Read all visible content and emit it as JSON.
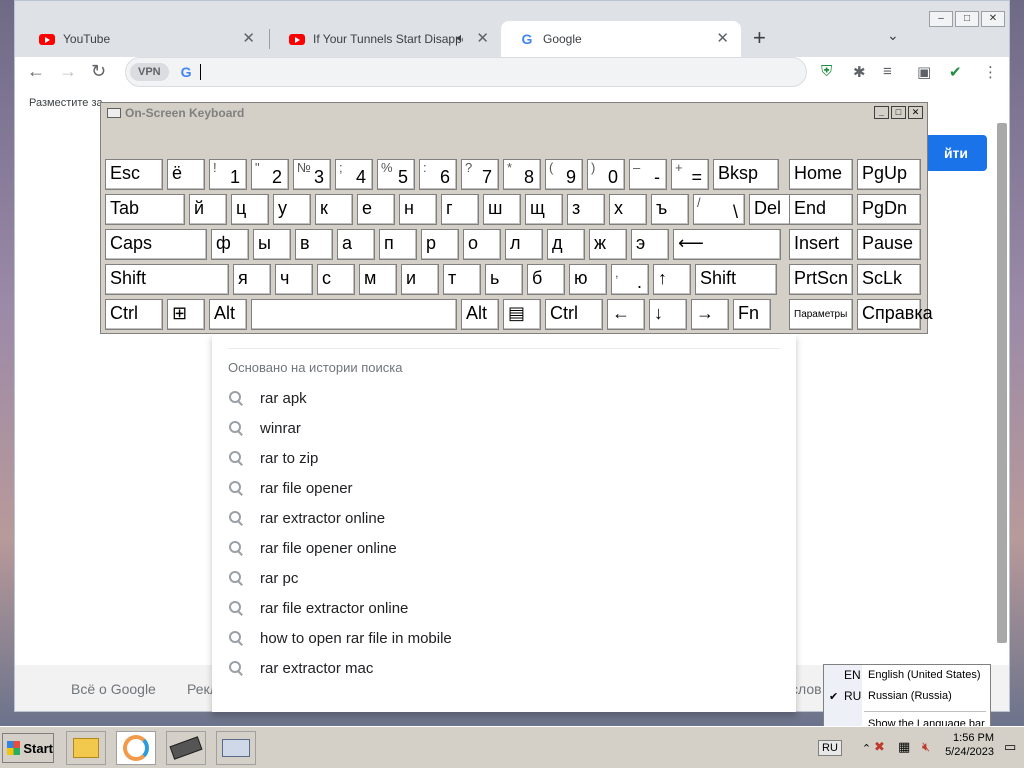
{
  "browser": {
    "tabs": [
      {
        "label": "YouTube",
        "icon": "youtube-icon"
      },
      {
        "label": "If Your Tunnels Start Disappear",
        "icon": "youtube-icon"
      },
      {
        "label": "Google",
        "icon": "google-icon"
      }
    ],
    "new_tab": "+",
    "omnibox": {
      "vpn_label": "VPN",
      "value": ""
    },
    "bookmark_text": "Разместите за",
    "signin_label": "йти"
  },
  "osk": {
    "title": "On-Screen Keyboard",
    "rows": [
      [
        [
          "Esc",
          ""
        ],
        [
          "ё",
          ""
        ],
        [
          "1",
          "!"
        ],
        [
          "2",
          "\""
        ],
        [
          "3",
          "№"
        ],
        [
          "4",
          ";"
        ],
        [
          "5",
          "%"
        ],
        [
          "6",
          ":"
        ],
        [
          "7",
          "?"
        ],
        [
          "8",
          "*"
        ],
        [
          "9",
          "("
        ],
        [
          "0",
          ")"
        ],
        [
          "-",
          "–"
        ],
        [
          "=",
          "+"
        ],
        [
          "Bksp",
          ""
        ],
        [
          "Home",
          ""
        ],
        [
          "PgUp",
          ""
        ]
      ],
      [
        [
          "Tab",
          ""
        ],
        [
          "й",
          ""
        ],
        [
          "ц",
          ""
        ],
        [
          "у",
          ""
        ],
        [
          "к",
          ""
        ],
        [
          "е",
          ""
        ],
        [
          "н",
          ""
        ],
        [
          "г",
          ""
        ],
        [
          "ш",
          ""
        ],
        [
          "щ",
          ""
        ],
        [
          "з",
          ""
        ],
        [
          "х",
          ""
        ],
        [
          "ъ",
          ""
        ],
        [
          "\\",
          "/"
        ],
        [
          "Del",
          ""
        ],
        [
          "End",
          ""
        ],
        [
          "PgDn",
          ""
        ]
      ],
      [
        [
          "Caps",
          ""
        ],
        [
          "ф",
          ""
        ],
        [
          "ы",
          ""
        ],
        [
          "в",
          ""
        ],
        [
          "а",
          ""
        ],
        [
          "п",
          ""
        ],
        [
          "р",
          ""
        ],
        [
          "о",
          ""
        ],
        [
          "л",
          ""
        ],
        [
          "д",
          ""
        ],
        [
          "ж",
          ""
        ],
        [
          "э",
          ""
        ],
        [
          "⟵",
          ""
        ],
        [
          "Insert",
          ""
        ],
        [
          "Pause",
          ""
        ]
      ],
      [
        [
          "Shift",
          ""
        ],
        [
          "я",
          ""
        ],
        [
          "ч",
          ""
        ],
        [
          "с",
          ""
        ],
        [
          "м",
          ""
        ],
        [
          "и",
          ""
        ],
        [
          "т",
          ""
        ],
        [
          "ь",
          ""
        ],
        [
          "б",
          ""
        ],
        [
          "ю",
          ""
        ],
        [
          ".",
          ","
        ],
        [
          "↑",
          ""
        ],
        [
          "Shift",
          ""
        ],
        [
          "PrtScn",
          ""
        ],
        [
          "ScLk",
          ""
        ]
      ],
      [
        [
          "Ctrl",
          ""
        ],
        [
          "⊞",
          ""
        ],
        [
          "Alt",
          ""
        ],
        [
          "",
          ""
        ],
        [
          "Alt",
          ""
        ],
        [
          "▤",
          ""
        ],
        [
          "Ctrl",
          ""
        ],
        [
          "←",
          ""
        ],
        [
          "↓",
          ""
        ],
        [
          "→",
          ""
        ],
        [
          "Fn",
          ""
        ],
        [
          "Параметры",
          ""
        ],
        [
          "Справка",
          ""
        ]
      ]
    ]
  },
  "suggestions": {
    "heading": "Основано на истории поиска",
    "items": [
      "rar apk",
      "winrar",
      "rar to zip",
      "rar file opener",
      "rar extractor online",
      "rar file opener online",
      "rar pc",
      "rar file extractor online",
      "how to open rar file in mobile",
      "rar extractor mac"
    ]
  },
  "footer": {
    "about": "Всё о Google",
    "ads": "Рекл",
    "right": "слов"
  },
  "language_popup": {
    "items": [
      {
        "code": "EN",
        "name": "English (United States)",
        "checked": false
      },
      {
        "code": "RU",
        "name": "Russian (Russia)",
        "checked": true
      }
    ],
    "show_bar": "Show the Language bar"
  },
  "taskbar": {
    "start_label": "Start",
    "lang_indicator": "RU",
    "time": "1:56 PM",
    "date": "5/24/2023"
  }
}
